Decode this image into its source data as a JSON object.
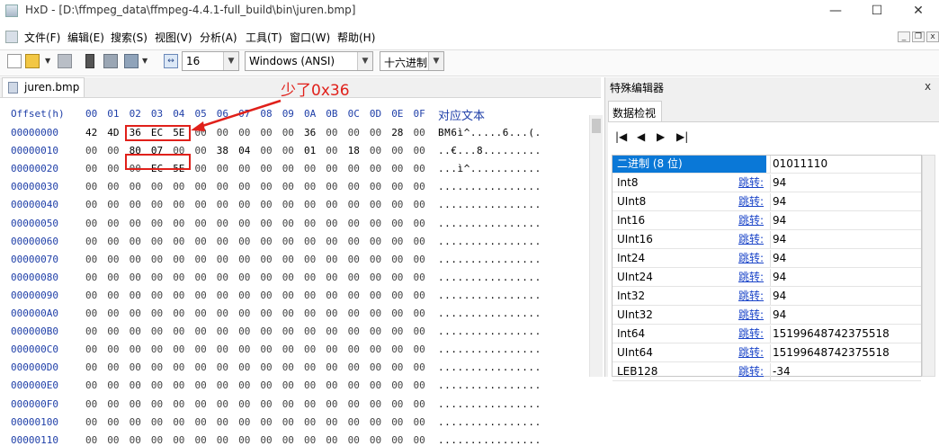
{
  "window": {
    "title": "HxD - [D:\\ffmpeg_data\\ffmpeg-4.4.1-full_build\\bin\\juren.bmp]",
    "min": "—",
    "max": "☐",
    "close": "✕"
  },
  "menu": [
    "文件(F)",
    "编辑(E)",
    "搜索(S)",
    "视图(V)",
    "分析(A)",
    "工具(T)",
    "窗口(W)",
    "帮助(H)"
  ],
  "mdi": {
    "min": "_",
    "restore": "❐",
    "close": "x"
  },
  "toolbar": {
    "bytes_per_row": "16",
    "charset": "Windows (ANSI)",
    "offset_base": "十六进制",
    "icons": [
      "new-icon",
      "open-icon",
      "save-icon",
      "close-file-icon",
      "disk-icon",
      "ram-icon",
      "export-icon",
      "columns-icon"
    ]
  },
  "editor": {
    "tab": "juren.bmp",
    "header_offset": "Offset(h)",
    "header_cols": [
      "00",
      "01",
      "02",
      "03",
      "04",
      "05",
      "06",
      "07",
      "08",
      "09",
      "0A",
      "0B",
      "0C",
      "0D",
      "0E",
      "0F"
    ],
    "header_text": "对应文本",
    "rows": [
      {
        "offset": "00000000",
        "bytes": [
          "42",
          "4D",
          "36",
          "EC",
          "5E",
          "00",
          "00",
          "00",
          "00",
          "00",
          "36",
          "00",
          "00",
          "00",
          "28",
          "00"
        ],
        "ascii": "BM6ì^.....6...(."
      },
      {
        "offset": "00000010",
        "bytes": [
          "00",
          "00",
          "80",
          "07",
          "00",
          "00",
          "38",
          "04",
          "00",
          "00",
          "01",
          "00",
          "18",
          "00",
          "00",
          "00"
        ],
        "ascii": "..€...8........."
      },
      {
        "offset": "00000020",
        "bytes": [
          "00",
          "00",
          "00",
          "EC",
          "5E",
          "00",
          "00",
          "00",
          "00",
          "00",
          "00",
          "00",
          "00",
          "00",
          "00",
          "00"
        ],
        "ascii": "...ì^..........."
      },
      {
        "offset": "00000030",
        "bytes": [
          "00",
          "00",
          "00",
          "00",
          "00",
          "00",
          "00",
          "00",
          "00",
          "00",
          "00",
          "00",
          "00",
          "00",
          "00",
          "00"
        ],
        "ascii": "................"
      },
      {
        "offset": "00000040",
        "bytes": [
          "00",
          "00",
          "00",
          "00",
          "00",
          "00",
          "00",
          "00",
          "00",
          "00",
          "00",
          "00",
          "00",
          "00",
          "00",
          "00"
        ],
        "ascii": "................"
      },
      {
        "offset": "00000050",
        "bytes": [
          "00",
          "00",
          "00",
          "00",
          "00",
          "00",
          "00",
          "00",
          "00",
          "00",
          "00",
          "00",
          "00",
          "00",
          "00",
          "00"
        ],
        "ascii": "................"
      },
      {
        "offset": "00000060",
        "bytes": [
          "00",
          "00",
          "00",
          "00",
          "00",
          "00",
          "00",
          "00",
          "00",
          "00",
          "00",
          "00",
          "00",
          "00",
          "00",
          "00"
        ],
        "ascii": "................"
      },
      {
        "offset": "00000070",
        "bytes": [
          "00",
          "00",
          "00",
          "00",
          "00",
          "00",
          "00",
          "00",
          "00",
          "00",
          "00",
          "00",
          "00",
          "00",
          "00",
          "00"
        ],
        "ascii": "................"
      },
      {
        "offset": "00000080",
        "bytes": [
          "00",
          "00",
          "00",
          "00",
          "00",
          "00",
          "00",
          "00",
          "00",
          "00",
          "00",
          "00",
          "00",
          "00",
          "00",
          "00"
        ],
        "ascii": "................"
      },
      {
        "offset": "00000090",
        "bytes": [
          "00",
          "00",
          "00",
          "00",
          "00",
          "00",
          "00",
          "00",
          "00",
          "00",
          "00",
          "00",
          "00",
          "00",
          "00",
          "00"
        ],
        "ascii": "................"
      },
      {
        "offset": "000000A0",
        "bytes": [
          "00",
          "00",
          "00",
          "00",
          "00",
          "00",
          "00",
          "00",
          "00",
          "00",
          "00",
          "00",
          "00",
          "00",
          "00",
          "00"
        ],
        "ascii": "................"
      },
      {
        "offset": "000000B0",
        "bytes": [
          "00",
          "00",
          "00",
          "00",
          "00",
          "00",
          "00",
          "00",
          "00",
          "00",
          "00",
          "00",
          "00",
          "00",
          "00",
          "00"
        ],
        "ascii": "................"
      },
      {
        "offset": "000000C0",
        "bytes": [
          "00",
          "00",
          "00",
          "00",
          "00",
          "00",
          "00",
          "00",
          "00",
          "00",
          "00",
          "00",
          "00",
          "00",
          "00",
          "00"
        ],
        "ascii": "................"
      },
      {
        "offset": "000000D0",
        "bytes": [
          "00",
          "00",
          "00",
          "00",
          "00",
          "00",
          "00",
          "00",
          "00",
          "00",
          "00",
          "00",
          "00",
          "00",
          "00",
          "00"
        ],
        "ascii": "................"
      },
      {
        "offset": "000000E0",
        "bytes": [
          "00",
          "00",
          "00",
          "00",
          "00",
          "00",
          "00",
          "00",
          "00",
          "00",
          "00",
          "00",
          "00",
          "00",
          "00",
          "00"
        ],
        "ascii": "................"
      },
      {
        "offset": "000000F0",
        "bytes": [
          "00",
          "00",
          "00",
          "00",
          "00",
          "00",
          "00",
          "00",
          "00",
          "00",
          "00",
          "00",
          "00",
          "00",
          "00",
          "00"
        ],
        "ascii": "................"
      },
      {
        "offset": "00000100",
        "bytes": [
          "00",
          "00",
          "00",
          "00",
          "00",
          "00",
          "00",
          "00",
          "00",
          "00",
          "00",
          "00",
          "00",
          "00",
          "00",
          "00"
        ],
        "ascii": "................"
      },
      {
        "offset": "00000110",
        "bytes": [
          "00",
          "00",
          "00",
          "00",
          "00",
          "00",
          "00",
          "00",
          "00",
          "00",
          "00",
          "00",
          "00",
          "00",
          "00",
          "00"
        ],
        "ascii": "................"
      }
    ]
  },
  "annotation": {
    "text": "少了0x36",
    "color": "#e0201a"
  },
  "inspector": {
    "title": "特殊编辑器",
    "close": "x",
    "tab": "数据检视",
    "nav": [
      "|◀",
      "◀",
      "▶",
      "▶|"
    ],
    "jump_label": "跳转:",
    "rows": [
      {
        "name": "二进制 (8 位)",
        "value": "01011110",
        "selected": true,
        "jump": false
      },
      {
        "name": "Int8",
        "value": "94",
        "jump": true
      },
      {
        "name": "UInt8",
        "value": "94",
        "jump": true
      },
      {
        "name": "Int16",
        "value": "94",
        "jump": true
      },
      {
        "name": "UInt16",
        "value": "94",
        "jump": true
      },
      {
        "name": "Int24",
        "value": "94",
        "jump": true
      },
      {
        "name": "UInt24",
        "value": "94",
        "jump": true
      },
      {
        "name": "Int32",
        "value": "94",
        "jump": true
      },
      {
        "name": "UInt32",
        "value": "94",
        "jump": true
      },
      {
        "name": "Int64",
        "value": "15199648742375518",
        "jump": true
      },
      {
        "name": "UInt64",
        "value": "15199648742375518",
        "jump": true
      },
      {
        "name": "LEB128",
        "value": "-34",
        "jump": true
      }
    ]
  }
}
